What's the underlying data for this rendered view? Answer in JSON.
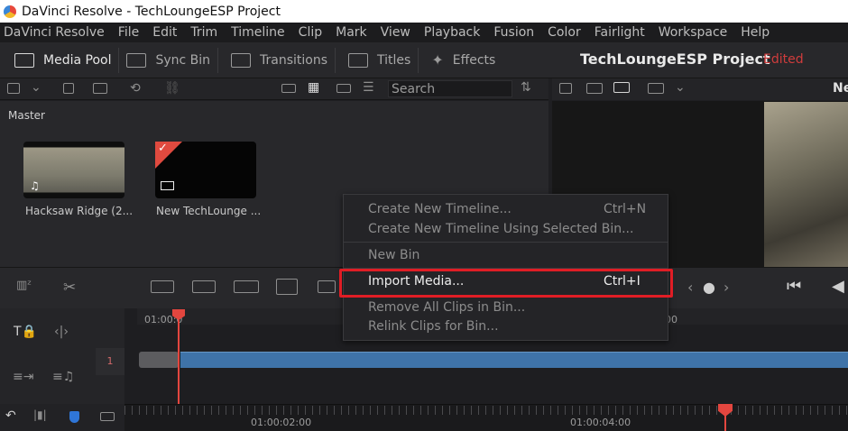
{
  "window": {
    "title": "DaVinci Resolve - TechLoungeESP Project"
  },
  "menu": [
    "DaVinci Resolve",
    "File",
    "Edit",
    "Trim",
    "Timeline",
    "Clip",
    "Mark",
    "View",
    "Playback",
    "Fusion",
    "Color",
    "Fairlight",
    "Workspace",
    "Help"
  ],
  "toolbar": {
    "media_pool": "Media Pool",
    "sync_bin": "Sync Bin",
    "transitions": "Transitions",
    "titles": "Titles",
    "effects": "Effects",
    "project_title": "TechLoungeESP Project",
    "status": "Edited"
  },
  "viewer": {
    "label": "Ne"
  },
  "search": {
    "placeholder": "Search"
  },
  "pool": {
    "bin_name": "Master",
    "clips": [
      {
        "name": "Hacksaw Ridge (2..."
      },
      {
        "name": "New TechLounge ..."
      }
    ]
  },
  "context_menu": {
    "items": [
      {
        "label": "Create New Timeline...",
        "shortcut": "Ctrl+N"
      },
      {
        "label": "Create New Timeline Using Selected Bin..."
      },
      {
        "label": "New Bin"
      },
      {
        "label": "Import Media...",
        "shortcut": "Ctrl+I"
      },
      {
        "label": "Remove All Clips in Bin..."
      },
      {
        "label": "Relink Clips for Bin..."
      }
    ]
  },
  "timeline": {
    "track_number": "1",
    "ruler_top": [
      "01:00:0",
      "00"
    ],
    "ruler_bottom": [
      "01:00:02:00",
      "01:00:04:00"
    ]
  },
  "colors": {
    "accent_red": "#e3463f",
    "clip_blue": "#3f73a8",
    "highlight_box": "#e01d25"
  }
}
